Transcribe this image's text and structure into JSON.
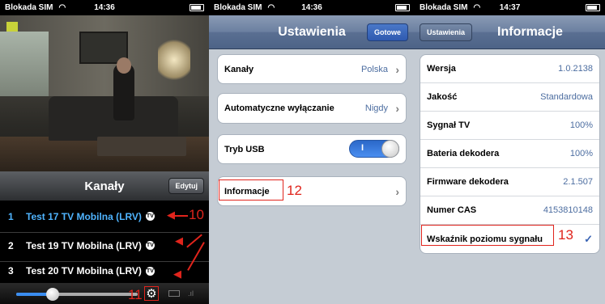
{
  "panel1": {
    "status": {
      "carrier": "Blokada SIM",
      "time": "14:36"
    },
    "list_title": "Kanały",
    "edit_label": "Edytuj",
    "channels": [
      {
        "num": "1",
        "name": "Test 17 TV Mobilna (LRV)",
        "active": true
      },
      {
        "num": "2",
        "name": "Test 19 TV Mobilna (LRV)",
        "active": false
      },
      {
        "num": "3",
        "name": "Test 20 TV Mobilna (LRV)",
        "active": false
      }
    ],
    "badge": "TV",
    "volume_level": 0.3
  },
  "panel2": {
    "status": {
      "carrier": "Blokada SIM",
      "time": "14:36"
    },
    "title": "Ustawienia",
    "done_label": "Gotowe",
    "rows": {
      "channels": {
        "label": "Kanały",
        "value": "Polska"
      },
      "autooff": {
        "label": "Automatyczne wyłączanie",
        "value": "Nigdy"
      },
      "usb": {
        "label": "Tryb USB",
        "toggle": "I"
      },
      "info": {
        "label": "Informacje"
      }
    }
  },
  "panel3": {
    "status": {
      "carrier": "Blokada SIM",
      "time": "14:37"
    },
    "back_label": "Ustawienia",
    "title": "Informacje",
    "rows": [
      {
        "label": "Wersja",
        "value": "1.0.2138"
      },
      {
        "label": "Jakość",
        "value": "Standardowa"
      },
      {
        "label": "Sygnał TV",
        "value": "100%"
      },
      {
        "label": "Bateria dekodera",
        "value": "100%"
      },
      {
        "label": "Firmware dekodera",
        "value": "2.1.507"
      },
      {
        "label": "Numer CAS",
        "value": "4153810148"
      }
    ],
    "signal_row": {
      "label": "Wskaźnik poziomu sygnału",
      "check": "✓"
    }
  },
  "annotations": {
    "a10": "10",
    "a11": "11",
    "a12": "12",
    "a13": "13"
  },
  "colors": {
    "annotation": "#e0241c",
    "accent": "#4fb4ff",
    "value_text": "#4c6da0"
  }
}
